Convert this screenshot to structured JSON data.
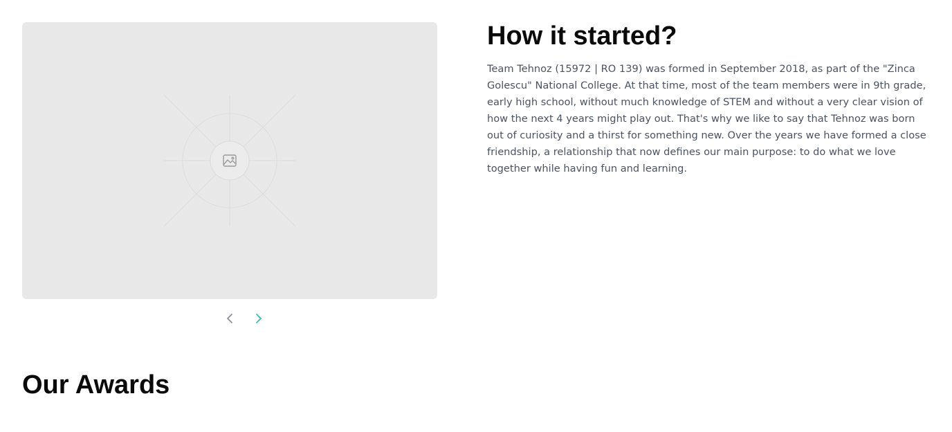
{
  "story": {
    "title": "How it started?",
    "body": "Team Tehnoz (15972 | RO 139) was formed in September 2018, as part of the \"Zinca Golescu\" National College. At that time, most of the team members were in 9th grade, early high school, without much knowledge of STEM and without a very clear vision of how the next 4 years might play out. That's why we like to say that Tehnoz was born out of curiosity and a thirst for something new. Over the years we have formed a close friendship, a relationship that now defines our main purpose: to do what we love together while having fun and learning."
  },
  "carousel": {
    "image_icon": "image-placeholder-icon",
    "prev_icon": "chevron-left-icon",
    "next_icon": "chevron-right-icon",
    "colors": {
      "background": "#e8e8e8",
      "prev_arrow": "#8a8f96",
      "next_arrow": "#2fc0b0"
    }
  },
  "awards": {
    "title": "Our Awards"
  }
}
